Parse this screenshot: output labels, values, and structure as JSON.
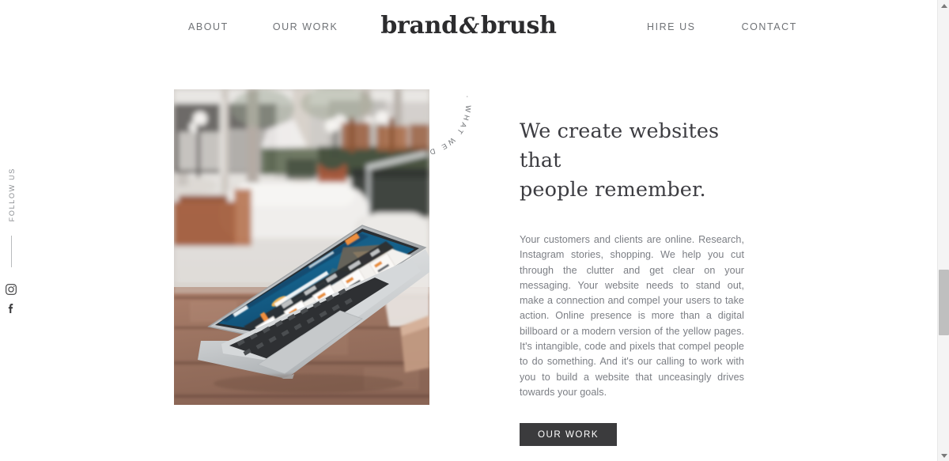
{
  "site": {
    "logo_prefix": "brand",
    "logo_amp": "&",
    "logo_suffix": "brush"
  },
  "nav": {
    "left_items": [
      {
        "label": "ABOUT"
      },
      {
        "label": "OUR WORK"
      }
    ],
    "right_items": [
      {
        "label": "HIRE US"
      },
      {
        "label": "CONTACT"
      }
    ]
  },
  "social_rail": {
    "label": "FOLLOW US",
    "icons": [
      {
        "name": "instagram-icon"
      },
      {
        "name": "facebook-icon"
      }
    ]
  },
  "badge": {
    "text": "· WHAT WE DO · WHAT WE DO "
  },
  "hero_image": {
    "alt": "Open MacBook laptop on a wooden table at an outdoor patio cafe, screen showing a Maui rafting tour booking website",
    "screen": {
      "brand": "ULTIMATE",
      "headline": "Maui's Ultimate Rafting Adventures",
      "cta": "BOOK NOW",
      "partners": [
        "NAT GEO",
        "travel",
        "CNN",
        "FLIPKEY",
        "TRIP"
      ],
      "cards": [
        {
          "price": "$99",
          "title": "Lanai Snorkel Dolphin Tour",
          "button": "BOOK"
        },
        {
          "price": "$159",
          "title": "Lanai Snorkel Dolphin Tour",
          "button": "BOOK"
        },
        {
          "price": "$265",
          "title": "Private Boat Charter",
          "button": "BOOK"
        },
        {
          "price": "$54",
          "title": "2 HR Whale Watch",
          "button": "BOOK"
        },
        {
          "price": "$65",
          "title": "VIP Whale Watch",
          "button": "BOOK"
        }
      ]
    }
  },
  "main": {
    "headline_line1": "We create websites that",
    "headline_line2": "people remember.",
    "paragraph": "Your customers and clients are online. Research, Instagram stories, shopping. We help you cut through the clutter and get clear on your messaging. Your website needs to stand out, make a connection and compel your users to take action. Online presence is more than a digital billboard or a modern version of the yellow pages. It's intangible, code and pixels that compel people to do something. And it's our calling to work with you to build a website that unceasingly drives towards your goals.",
    "cta_label": "OUR WORK"
  },
  "colors": {
    "page_background": "#ffffff",
    "nav_link": "#6f7276",
    "logo": "#2c2c2e",
    "headline": "#3c3c41",
    "body_text": "#7b7e84",
    "cta_background": "#3b3b3d",
    "cta_text": "#ffffff",
    "scrollbar_thumb": "#bfbfbf",
    "scrollbar_track": "#f4f4f4"
  }
}
